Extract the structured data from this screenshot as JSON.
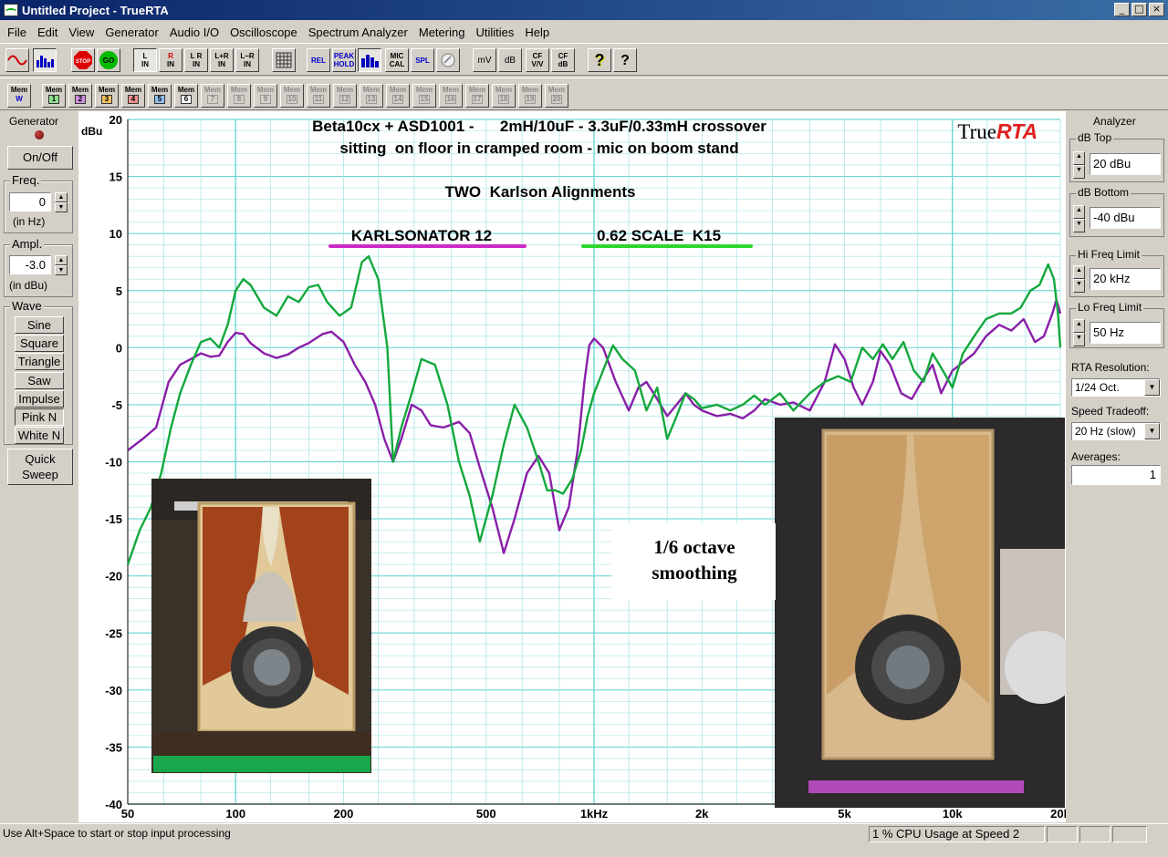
{
  "window": {
    "title": "Untitled Project - TrueRTA"
  },
  "menu": [
    "File",
    "Edit",
    "View",
    "Generator",
    "Audio I/O",
    "Oscilloscope",
    "Spectrum Analyzer",
    "Metering",
    "Utilities",
    "Help"
  ],
  "toolbar": {
    "stop_label": "STOP",
    "go_label": "GO",
    "l_in": [
      "L",
      "IN"
    ],
    "r_in": [
      "R",
      "IN"
    ],
    "l_r_in": [
      "L R",
      "IN"
    ],
    "l_plus_r": [
      "L+R",
      "IN"
    ],
    "l_minus_r": [
      "L−R",
      "IN"
    ],
    "rel": "REL",
    "peak_hold": [
      "PEAK",
      "HOLD"
    ],
    "mic_cal": [
      "MIC",
      "CAL"
    ],
    "spl": "SPL",
    "mv": "mV",
    "db": "dB",
    "cf_vv": [
      "CF",
      "V/V"
    ],
    "cf_db": [
      "CF",
      "dB"
    ],
    "help_icon": "?",
    "context_help_icon": "?"
  },
  "memories": {
    "w": [
      "Mem",
      "W"
    ],
    "active": [
      [
        "Mem",
        "1"
      ],
      [
        "Mem",
        "2"
      ],
      [
        "Mem",
        "3"
      ],
      [
        "Mem",
        "4"
      ],
      [
        "Mem",
        "5"
      ],
      [
        "Mem",
        "6"
      ]
    ],
    "inactive": [
      [
        "Mem",
        "7"
      ],
      [
        "Mem",
        "8"
      ],
      [
        "Mem",
        "9"
      ],
      [
        "Mem",
        "10"
      ],
      [
        "Mem",
        "11"
      ],
      [
        "Mem",
        "12"
      ],
      [
        "Mem",
        "13"
      ],
      [
        "Mem",
        "14"
      ],
      [
        "Mem",
        "15"
      ],
      [
        "Mem",
        "16"
      ],
      [
        "Mem",
        "17"
      ],
      [
        "Mem",
        "18"
      ],
      [
        "Mem",
        "19"
      ],
      [
        "Mem",
        "20"
      ]
    ],
    "colors": [
      "#00a000",
      "#a000a0",
      "#c06000",
      "#c00000",
      "#0060c0",
      "#008000"
    ]
  },
  "generator": {
    "title": "Generator",
    "on_off": "On/Off",
    "freq_label": "Freq.",
    "freq_value": "0",
    "freq_unit": "(in Hz)",
    "ampl_label": "Ampl.",
    "ampl_value": "-3.0",
    "ampl_unit": "(in dBu)",
    "wave_label": "Wave",
    "waves": [
      "Sine",
      "Square",
      "Triangle",
      "Saw",
      "Impulse",
      "Pink N",
      "White N"
    ],
    "selected_wave": "Pink N",
    "quick_sweep": [
      "Quick",
      "Sweep"
    ]
  },
  "analyzer": {
    "title": "Analyzer",
    "db_top_label": "dB Top",
    "db_top_value": "20 dBu",
    "db_bottom_label": "dB Bottom",
    "db_bottom_value": "-40 dBu",
    "hi_freq_label": "Hi Freq Limit",
    "hi_freq_value": "20 kHz",
    "lo_freq_label": "Lo Freq Limit",
    "lo_freq_value": "50 Hz",
    "rta_res_label": "RTA Resolution:",
    "rta_res_value": "1/24 Oct.",
    "speed_label": "Speed Tradeoff:",
    "speed_value": "20 Hz (slow)",
    "averages_label": "Averages:",
    "averages_value": "1"
  },
  "chart_data": {
    "type": "line",
    "title_lines": [
      "Beta10cx + ASD1001 -      2mH/10uF - 3.3uF/0.33mH crossover",
      "sitting  on floor in cramped room - mic on boom stand"
    ],
    "subtitle": "TWO  Karlson Alignments",
    "ylabel": "dBu",
    "logo": [
      "True",
      "RTA"
    ],
    "annotation": [
      "1/6 octave",
      "smoothing"
    ],
    "xscale": "log",
    "xlim": [
      50,
      20000
    ],
    "ylim": [
      -40,
      20
    ],
    "yticks": [
      20,
      15,
      10,
      5,
      0,
      -5,
      -10,
      -15,
      -20,
      -25,
      -30,
      -35,
      -40
    ],
    "xticks": [
      {
        "v": 50,
        "label": "50"
      },
      {
        "v": 100,
        "label": "100"
      },
      {
        "v": 200,
        "label": "200"
      },
      {
        "v": 500,
        "label": "500"
      },
      {
        "v": 1000,
        "label": "1kHz"
      },
      {
        "v": 2000,
        "label": "2k"
      },
      {
        "v": 5000,
        "label": "5k"
      },
      {
        "v": 10000,
        "label": "10k"
      },
      {
        "v": 20000,
        "label": "20k"
      }
    ],
    "series": [
      {
        "name": "KARLSONATOR 12",
        "color": "#8a1fa8",
        "points": [
          [
            50,
            -9
          ],
          [
            55,
            -8
          ],
          [
            60,
            -7
          ],
          [
            65,
            -3
          ],
          [
            70,
            -1.5
          ],
          [
            75,
            -1
          ],
          [
            80,
            -0.5
          ],
          [
            85,
            -0.8
          ],
          [
            90,
            -0.7
          ],
          [
            95,
            0.5
          ],
          [
            100,
            1.3
          ],
          [
            105,
            1.2
          ],
          [
            110,
            0.4
          ],
          [
            120,
            -0.5
          ],
          [
            130,
            -0.9
          ],
          [
            140,
            -0.6
          ],
          [
            150,
            0
          ],
          [
            160,
            0.4
          ],
          [
            175,
            1.2
          ],
          [
            185,
            1.4
          ],
          [
            200,
            0.5
          ],
          [
            215,
            -1.5
          ],
          [
            230,
            -3
          ],
          [
            245,
            -5
          ],
          [
            260,
            -8
          ],
          [
            275,
            -10
          ],
          [
            290,
            -8
          ],
          [
            310,
            -5
          ],
          [
            330,
            -5.5
          ],
          [
            350,
            -6.8
          ],
          [
            380,
            -7
          ],
          [
            420,
            -6.5
          ],
          [
            450,
            -7.5
          ],
          [
            480,
            -10.5
          ],
          [
            520,
            -14
          ],
          [
            560,
            -18
          ],
          [
            600,
            -15
          ],
          [
            650,
            -11
          ],
          [
            700,
            -9.5
          ],
          [
            750,
            -11
          ],
          [
            800,
            -16
          ],
          [
            850,
            -14
          ],
          [
            900,
            -9
          ],
          [
            940,
            -3
          ],
          [
            970,
            0.2
          ],
          [
            1000,
            0.8
          ],
          [
            1060,
            0
          ],
          [
            1150,
            -3
          ],
          [
            1250,
            -5.5
          ],
          [
            1330,
            -3.5
          ],
          [
            1400,
            -3
          ],
          [
            1500,
            -4.5
          ],
          [
            1600,
            -6
          ],
          [
            1700,
            -5
          ],
          [
            1800,
            -4
          ],
          [
            1900,
            -5
          ],
          [
            2000,
            -5.5
          ],
          [
            2200,
            -6
          ],
          [
            2400,
            -5.8
          ],
          [
            2600,
            -6.2
          ],
          [
            2800,
            -5.5
          ],
          [
            3000,
            -4.5
          ],
          [
            3300,
            -5
          ],
          [
            3600,
            -4.8
          ],
          [
            4000,
            -5.5
          ],
          [
            4400,
            -3
          ],
          [
            4700,
            0.3
          ],
          [
            5000,
            -1
          ],
          [
            5300,
            -3.5
          ],
          [
            5600,
            -5
          ],
          [
            6000,
            -3
          ],
          [
            6300,
            -0.3
          ],
          [
            6700,
            -1.5
          ],
          [
            7200,
            -4
          ],
          [
            7700,
            -4.5
          ],
          [
            8200,
            -3
          ],
          [
            8800,
            -1.5
          ],
          [
            9300,
            -4
          ],
          [
            10000,
            -2
          ],
          [
            10700,
            -1.3
          ],
          [
            11500,
            -0.5
          ],
          [
            12400,
            1
          ],
          [
            13500,
            2
          ],
          [
            14600,
            1.5
          ],
          [
            15800,
            2.5
          ],
          [
            17000,
            0.5
          ],
          [
            18000,
            1
          ],
          [
            19000,
            3
          ],
          [
            19500,
            4.2
          ],
          [
            20000,
            3
          ]
        ]
      },
      {
        "name": "0.62 SCALE  K15",
        "color": "#14a83c",
        "points": [
          [
            50,
            -19
          ],
          [
            54,
            -16
          ],
          [
            58,
            -14
          ],
          [
            62,
            -11
          ],
          [
            66,
            -7
          ],
          [
            70,
            -4
          ],
          [
            75,
            -1.5
          ],
          [
            80,
            0.5
          ],
          [
            85,
            0.8
          ],
          [
            90,
            0
          ],
          [
            95,
            2
          ],
          [
            100,
            5
          ],
          [
            105,
            6
          ],
          [
            110,
            5.5
          ],
          [
            120,
            3.5
          ],
          [
            130,
            2.8
          ],
          [
            140,
            4.5
          ],
          [
            150,
            4
          ],
          [
            160,
            5.3
          ],
          [
            170,
            5.5
          ],
          [
            180,
            4
          ],
          [
            195,
            2.8
          ],
          [
            210,
            3.5
          ],
          [
            225,
            7.5
          ],
          [
            235,
            8
          ],
          [
            250,
            6
          ],
          [
            265,
            0
          ],
          [
            275,
            -10
          ],
          [
            290,
            -7
          ],
          [
            310,
            -4
          ],
          [
            330,
            -1
          ],
          [
            360,
            -1.5
          ],
          [
            390,
            -5
          ],
          [
            420,
            -10
          ],
          [
            450,
            -13
          ],
          [
            480,
            -17
          ],
          [
            520,
            -13
          ],
          [
            560,
            -8.5
          ],
          [
            600,
            -5
          ],
          [
            650,
            -7
          ],
          [
            700,
            -10
          ],
          [
            740,
            -12.5
          ],
          [
            780,
            -12.5
          ],
          [
            820,
            -12.8
          ],
          [
            870,
            -11.5
          ],
          [
            920,
            -9
          ],
          [
            960,
            -6
          ],
          [
            1000,
            -4
          ],
          [
            1060,
            -2
          ],
          [
            1130,
            0.2
          ],
          [
            1200,
            -1
          ],
          [
            1300,
            -2
          ],
          [
            1400,
            -5.5
          ],
          [
            1500,
            -3.5
          ],
          [
            1600,
            -8
          ],
          [
            1700,
            -6
          ],
          [
            1800,
            -4
          ],
          [
            1900,
            -4.5
          ],
          [
            2000,
            -5.3
          ],
          [
            2200,
            -5
          ],
          [
            2400,
            -5.5
          ],
          [
            2600,
            -5
          ],
          [
            2800,
            -4.2
          ],
          [
            3000,
            -5
          ],
          [
            3300,
            -4
          ],
          [
            3600,
            -5.5
          ],
          [
            4000,
            -4
          ],
          [
            4400,
            -3
          ],
          [
            4800,
            -2.5
          ],
          [
            5200,
            -3
          ],
          [
            5600,
            0
          ],
          [
            6000,
            -1
          ],
          [
            6400,
            0.3
          ],
          [
            6800,
            -1
          ],
          [
            7300,
            0.5
          ],
          [
            7800,
            -2
          ],
          [
            8300,
            -3
          ],
          [
            8800,
            -0.5
          ],
          [
            9400,
            -2
          ],
          [
            10000,
            -3.5
          ],
          [
            10700,
            -0.5
          ],
          [
            11500,
            1
          ],
          [
            12400,
            2.5
          ],
          [
            13500,
            3
          ],
          [
            14600,
            3
          ],
          [
            15500,
            3.5
          ],
          [
            16500,
            5
          ],
          [
            17500,
            5.5
          ],
          [
            18500,
            7.3
          ],
          [
            19200,
            6
          ],
          [
            19700,
            3
          ],
          [
            20000,
            0
          ]
        ]
      }
    ],
    "legend": [
      {
        "name": "KARLSONATOR 12",
        "color": "#cc29c8"
      },
      {
        "name": "0.62 SCALE  K15",
        "color": "#2ed62e"
      }
    ],
    "photos": [
      {
        "label": "KARLSONATOR 12 photo",
        "color": "#1aa64a"
      },
      {
        "label": "0.62 SCALE K15 photo",
        "color": "#b04ab8"
      }
    ]
  },
  "status": {
    "hint": "Use Alt+Space to start or stop input processing",
    "cpu": "1 % CPU Usage at Speed 2"
  }
}
